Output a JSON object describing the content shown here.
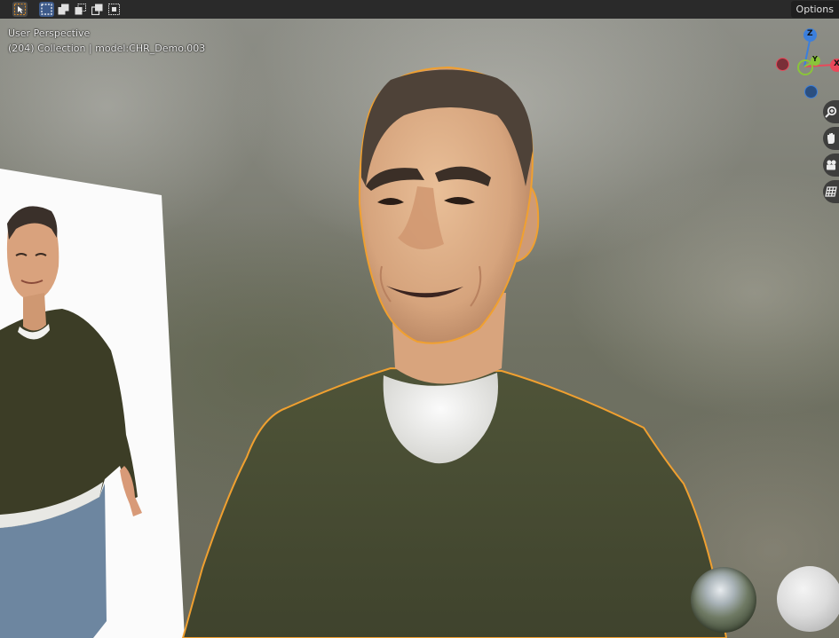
{
  "header": {
    "tools": [
      {
        "icon": "select-cursor-icon",
        "active": true
      },
      {
        "icon": "select-box-new-icon",
        "active": false
      },
      {
        "icon": "select-box-extend-icon",
        "active": false
      },
      {
        "icon": "select-box-subtract-icon",
        "active": false
      },
      {
        "icon": "select-box-invert-icon",
        "active": false
      },
      {
        "icon": "select-box-intersect-icon",
        "active": false
      }
    ],
    "options_label": "Options"
  },
  "viewport": {
    "perspective_label": "User Perspective",
    "collection_label": "(204) Collection | model:CHR_Demo.003"
  },
  "gizmo": {
    "z_label": "Z",
    "y_label": "Y",
    "x_label": "X",
    "colors": {
      "x": "#e8495a",
      "y": "#8ac43a",
      "z": "#3c7fdc"
    }
  },
  "nav_tools": [
    {
      "icon": "zoom-icon"
    },
    {
      "icon": "pan-hand-icon"
    },
    {
      "icon": "camera-icon"
    },
    {
      "icon": "ortho-grid-icon"
    }
  ],
  "colors": {
    "selection_outline": "#f0a030",
    "header_bg": "#2a2a2a"
  }
}
